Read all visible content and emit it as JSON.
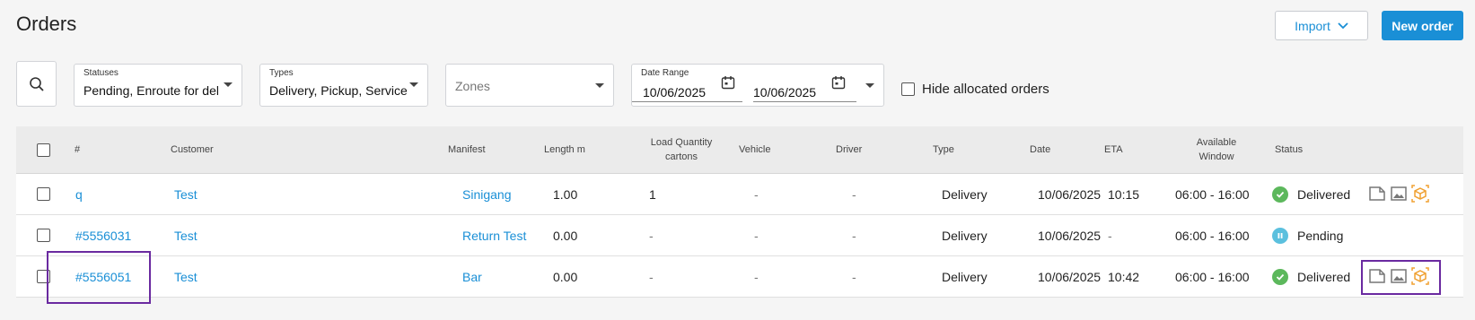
{
  "header": {
    "title": "Orders",
    "import_label": "Import",
    "new_order_label": "New order"
  },
  "filters": {
    "statuses": {
      "label": "Statuses",
      "value": "Pending, Enroute for del..."
    },
    "types": {
      "label": "Types",
      "value": "Delivery, Pickup, Service"
    },
    "zones": {
      "placeholder": "Zones"
    },
    "date_range": {
      "label": "Date Range",
      "from": "10/06/2025",
      "to": "10/06/2025"
    },
    "hide_allocated_label": "Hide allocated orders"
  },
  "table": {
    "columns": {
      "number": "#",
      "customer": "Customer",
      "manifest": "Manifest",
      "length": "Length m",
      "load_quantity": "Load Quantity cartons",
      "vehicle": "Vehicle",
      "driver": "Driver",
      "type": "Type",
      "date": "Date",
      "eta": "ETA",
      "window": "Available Window",
      "status": "Status"
    },
    "rows": [
      {
        "number": "q",
        "customer": "Test",
        "manifest": "Sinigang",
        "length": "1.00",
        "load": "1",
        "vehicle": "-",
        "driver": "-",
        "type": "Delivery",
        "date": "10/06/2025",
        "eta": "10:15",
        "window": "06:00 - 16:00",
        "status": "Delivered"
      },
      {
        "number": "#5556031",
        "customer": "Test",
        "manifest": "Return Test",
        "length": "0.00",
        "load": "-",
        "vehicle": "-",
        "driver": "-",
        "type": "Delivery",
        "date": "10/06/2025",
        "eta": "-",
        "window": "06:00 - 16:00",
        "status": "Pending"
      },
      {
        "number": "#5556051",
        "customer": "Test",
        "manifest": "Bar",
        "length": "0.00",
        "load": "-",
        "vehicle": "-",
        "driver": "-",
        "type": "Delivery",
        "date": "10/06/2025",
        "eta": "10:42",
        "window": "06:00 - 16:00",
        "status": "Delivered"
      }
    ]
  },
  "colors": {
    "accent": "#1a8fd6",
    "delivered": "#5cb85c",
    "pending": "#5bc0de",
    "highlight": "#6a2aa0",
    "action_orange": "#f0a030"
  },
  "icons": [
    "search-icon",
    "chevron-down-icon",
    "calendar-icon",
    "check-icon",
    "pause-icon",
    "document-icon",
    "image-icon",
    "package-icon"
  ]
}
